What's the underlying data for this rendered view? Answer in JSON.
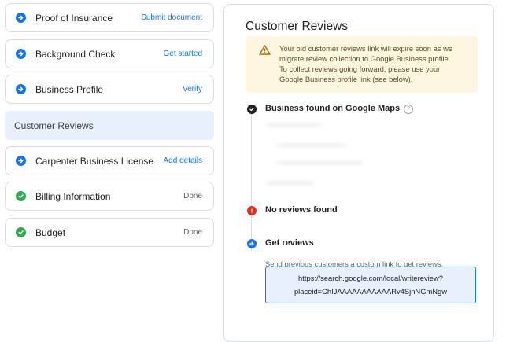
{
  "steps": [
    {
      "label": "Proof of Insurance",
      "action": "Submit document",
      "status": "pending",
      "icon": "arrow-right-icon"
    },
    {
      "label": "Background Check",
      "action": "Get started",
      "status": "pending",
      "icon": "arrow-right-icon"
    },
    {
      "label": "Business Profile",
      "action": "Verify",
      "status": "pending",
      "icon": "arrow-right-icon"
    },
    {
      "label": "Customer Reviews",
      "action": "",
      "status": "active",
      "icon": ""
    },
    {
      "label": "Carpenter Business License",
      "action": "Add details",
      "status": "pending",
      "icon": "arrow-right-icon"
    },
    {
      "label": "Billing Information",
      "action": "Done",
      "status": "done",
      "icon": "check-icon"
    },
    {
      "label": "Budget",
      "action": "Done",
      "status": "done",
      "icon": "check-icon"
    }
  ],
  "panel": {
    "title": "Customer Reviews",
    "warning": {
      "icon": "warning-triangle-icon",
      "line1": "Your old customer reviews link will expire soon as we",
      "line2": "migrate review collection to Google Business profile.",
      "line3": "To collect reviews going forward, please use your",
      "line4": "Google Business profile link (see below)."
    },
    "timeline": [
      {
        "title": "Business found on Google Maps",
        "icon": "check-icon",
        "color": "#202124",
        "help_icon": "?"
      },
      {
        "title": "No reviews found",
        "icon": "alert-icon",
        "color": "#d93025"
      },
      {
        "title": "Get reviews",
        "icon": "arrow-right-icon",
        "color": "#1a73e8",
        "description": "Send previous customers a custom link to get reviews.",
        "link_line1": "https://search.google.com/local/writereview?",
        "link_line2": "placeid=ChIJAAAAAAAAAAARv4SjnNGmNgw"
      }
    ]
  },
  "colors": {
    "accent": "#1a73e8",
    "success": "#34a853",
    "error": "#d93025",
    "warning_bg": "#fef7e0",
    "active_bg": "#e8f0fe"
  }
}
